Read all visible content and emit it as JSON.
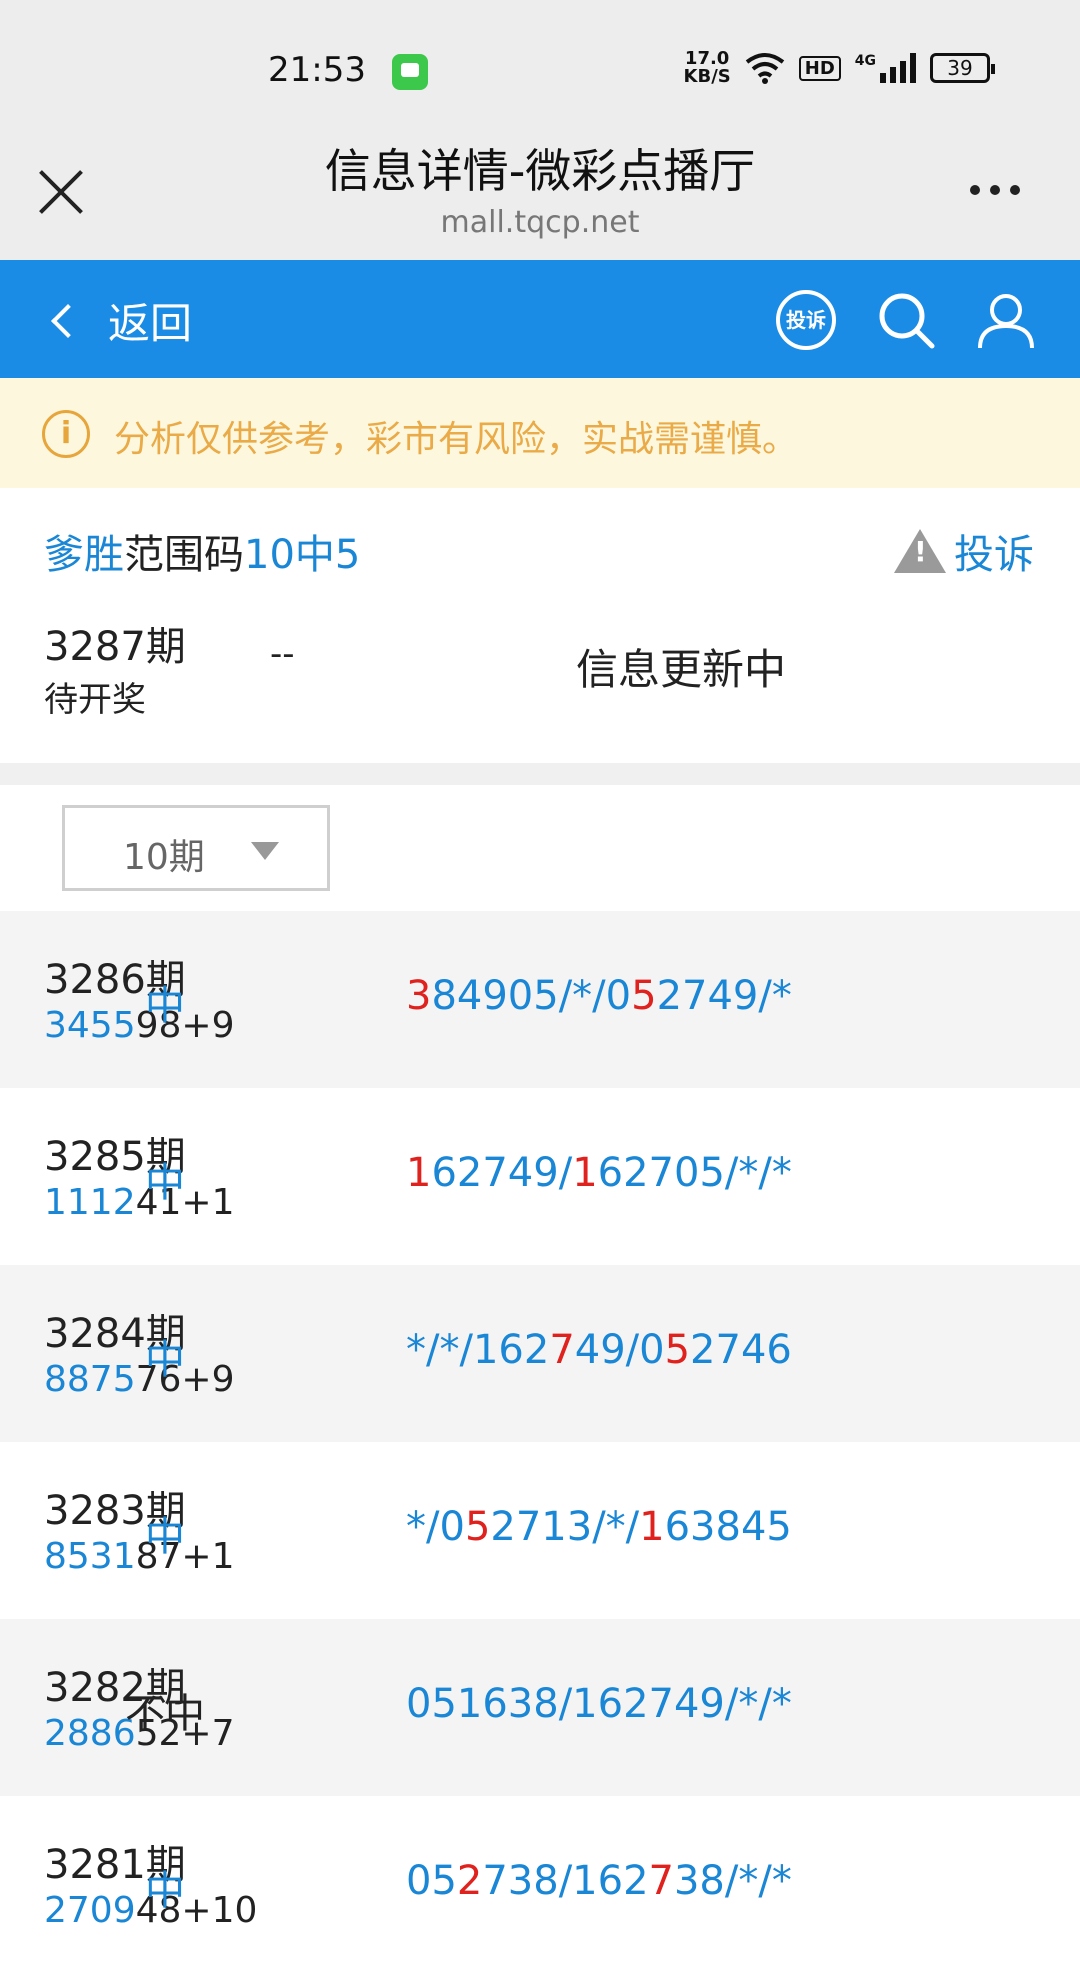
{
  "status_bar": {
    "time": "21:53",
    "speed_value": "17.0",
    "speed_unit": "KB/S",
    "hd": "HD",
    "network": "4G",
    "battery": "39"
  },
  "title_bar": {
    "title": "信息详情-微彩点播厅",
    "domain": "mall.tqcp.net"
  },
  "nav": {
    "back_label": "返回",
    "complain_icon_label": "投诉"
  },
  "notice": {
    "icon": "i",
    "text": "分析仅供参考，彩市有风险，实战需谨慎。"
  },
  "header": {
    "title_part1": "爹胜",
    "title_part2": "范围码",
    "title_part3": "10中5",
    "complain_label": "投诉",
    "current_issue": "3287期",
    "current_status": "待开奖",
    "current_dash": "--",
    "current_info": "信息更新中"
  },
  "period_select": {
    "value": "10期"
  },
  "rows": [
    {
      "issue": "3286期",
      "num_hl": "3455",
      "num_rest": "98+9",
      "result": "中",
      "pred": [
        [
          "3",
          "r"
        ],
        [
          "84905/*/0",
          "b"
        ],
        [
          "5",
          "r"
        ],
        [
          "2749/*",
          "b"
        ]
      ]
    },
    {
      "issue": "3285期",
      "num_hl": "1112",
      "num_rest": "41+1",
      "result": "中",
      "pred": [
        [
          "1",
          "r"
        ],
        [
          "62749/",
          "b"
        ],
        [
          "1",
          "r"
        ],
        [
          "62705/*/*",
          "b"
        ]
      ]
    },
    {
      "issue": "3284期",
      "num_hl": "8875",
      "num_rest": "76+9",
      "result": "中",
      "pred": [
        [
          "*/*/162",
          "b"
        ],
        [
          "7",
          "r"
        ],
        [
          "49/0",
          "b"
        ],
        [
          "5",
          "r"
        ],
        [
          "2746",
          "b"
        ]
      ]
    },
    {
      "issue": "3283期",
      "num_hl": "8531",
      "num_rest": "87+1",
      "result": "中",
      "pred": [
        [
          "*/0",
          "b"
        ],
        [
          "5",
          "r"
        ],
        [
          "2713/*/",
          "b"
        ],
        [
          "1",
          "r"
        ],
        [
          "63845",
          "b"
        ]
      ]
    },
    {
      "issue": "3282期",
      "num_hl": "2886",
      "num_rest": "52+7",
      "result": "不中",
      "pred": [
        [
          "051638/162749/*/*",
          "b"
        ]
      ]
    },
    {
      "issue": "3281期",
      "num_hl": "2709",
      "num_rest": "48+10",
      "result": "中",
      "pred": [
        [
          "05",
          "b"
        ],
        [
          "2",
          "r"
        ],
        [
          "738/162",
          "b"
        ],
        [
          "7",
          "r"
        ],
        [
          "38/*/*",
          "b"
        ]
      ]
    }
  ]
}
